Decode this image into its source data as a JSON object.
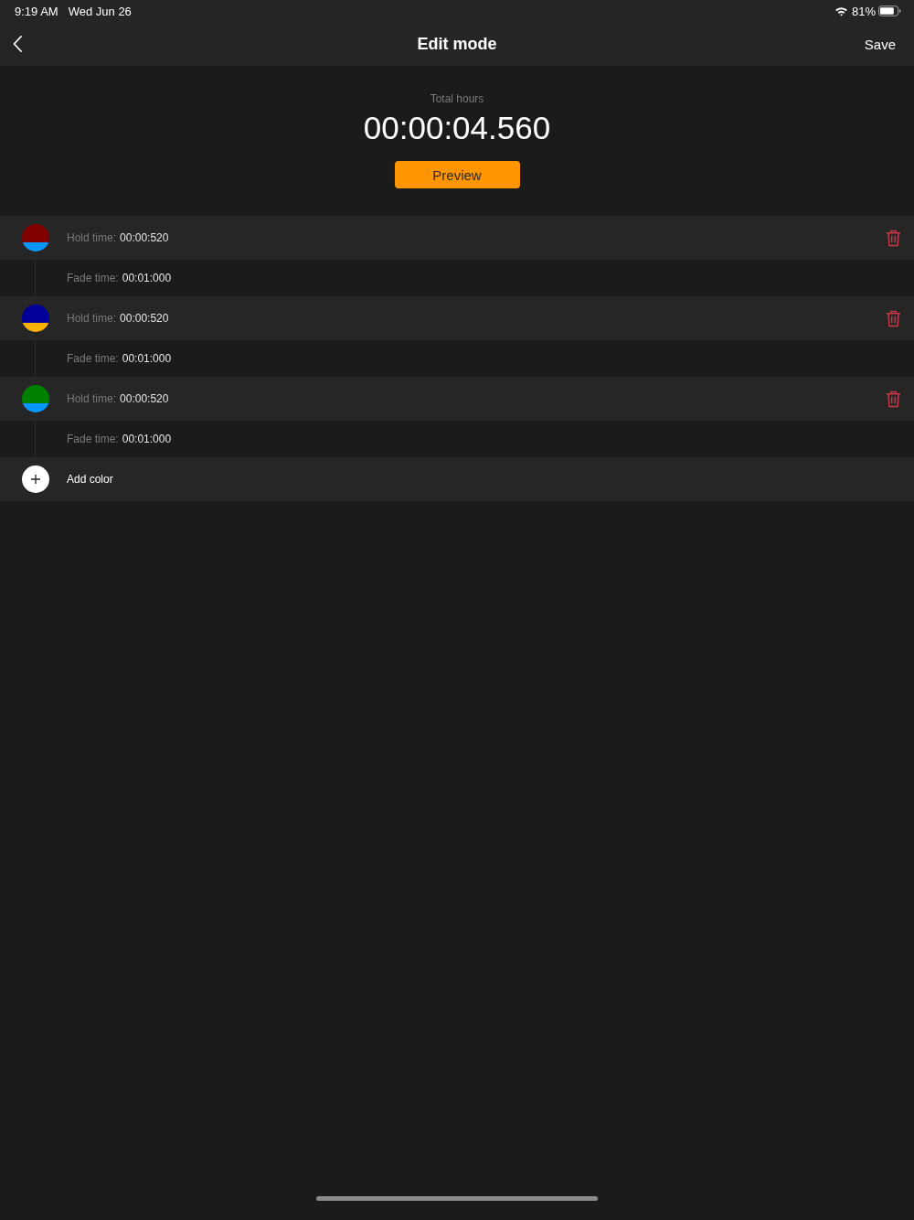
{
  "status_bar": {
    "time": "9:19 AM",
    "date": "Wed Jun 26",
    "battery": "81%"
  },
  "nav_bar": {
    "title": "Edit mode",
    "action": "Save"
  },
  "summary": {
    "label": "Total hours",
    "value": "00:00:04.560",
    "button": "Preview"
  },
  "steps": [
    {
      "swatch": [
        {
          "color": "#800000"
        },
        {
          "color": "#0a96ff"
        }
      ],
      "hold_label": "Hold time:",
      "hold_value": "00:00:520",
      "fade_label": "Fade time:",
      "fade_value": "00:01:000"
    },
    {
      "swatch": [
        {
          "color": "#000099"
        },
        {
          "color": "#ffb000"
        }
      ],
      "hold_label": "Hold time:",
      "hold_value": "00:00:520",
      "fade_label": "Fade time:",
      "fade_value": "00:01:000"
    },
    {
      "swatch": [
        {
          "color": "#008000"
        },
        {
          "color": "#0a96ff"
        }
      ],
      "hold_label": "Hold time:",
      "hold_value": "00:00:520",
      "fade_label": "Fade time:",
      "fade_value": "00:01:000"
    }
  ],
  "add_button": "Add color"
}
